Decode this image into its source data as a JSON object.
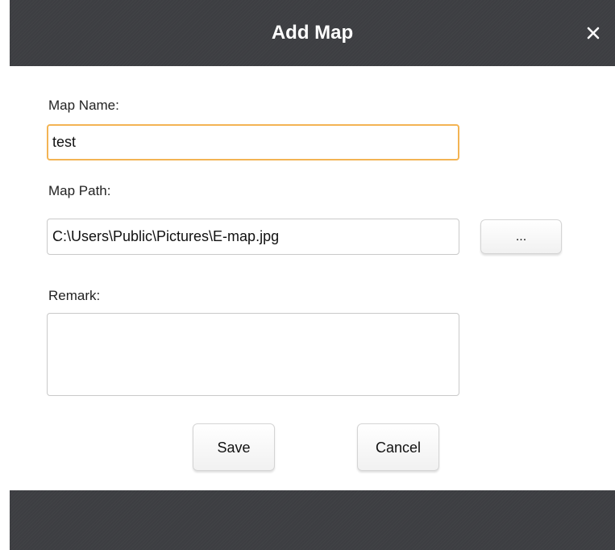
{
  "dialog": {
    "title": "Add Map",
    "close_icon": "close-icon"
  },
  "form": {
    "map_name_label": "Map Name:",
    "map_name_value": "test",
    "map_path_label": "Map Path:",
    "map_path_value": "C:\\Users\\Public\\Pictures\\E-map.jpg",
    "browse_label": "...",
    "remark_label": "Remark:",
    "remark_value": ""
  },
  "actions": {
    "save_label": "Save",
    "cancel_label": "Cancel"
  },
  "colors": {
    "titlebar": "#3d3e42",
    "focus_border": "#f3b454"
  }
}
